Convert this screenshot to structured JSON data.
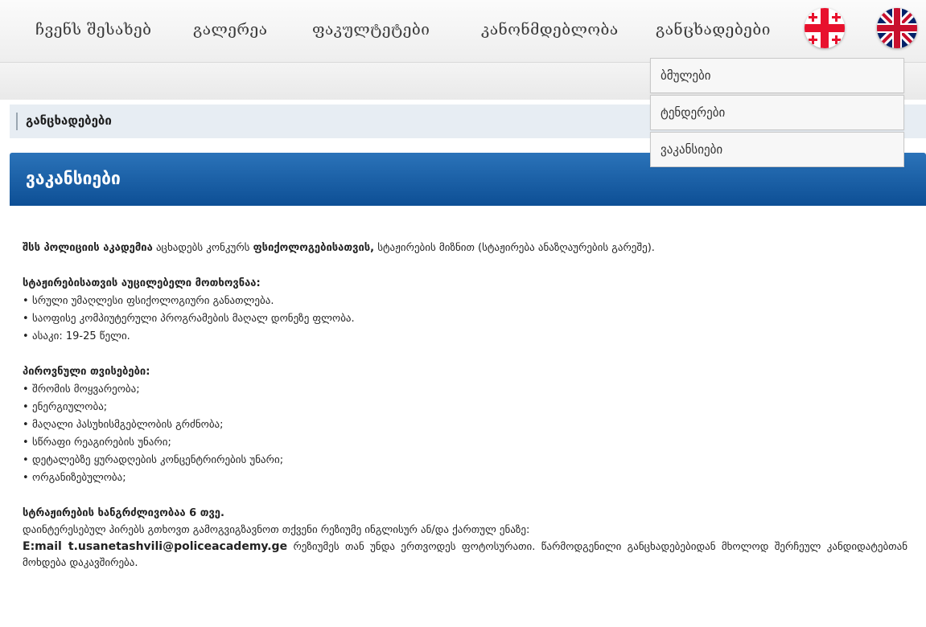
{
  "nav": {
    "items": [
      {
        "label": "ჩვენს შესახებ"
      },
      {
        "label": "გალერეა"
      },
      {
        "label": "ფაკულტეტები"
      },
      {
        "label": "კანონმდებლობა"
      },
      {
        "label": "განცხადებები"
      }
    ]
  },
  "flags": [
    {
      "icon": "georgia-flag-icon"
    },
    {
      "icon": "uk-flag-icon"
    }
  ],
  "breadcrumb": {
    "current": "განცხადებები"
  },
  "dropdown": {
    "items": [
      {
        "label": "ბმულები"
      },
      {
        "label": "ტენდერები"
      },
      {
        "label": "ვაკანსიები"
      }
    ]
  },
  "section": {
    "title": "ვაკანსიები"
  },
  "content": {
    "intro_org": "შსს პოლიციის აკადემია",
    "intro_mid": " აცხადებს კონკურს ",
    "intro_role": "ფსიქოლოგებისათვის,",
    "intro_end": " სტაჟირების მიზნით (სტაჟირება ანაზღაურების გარეშე).",
    "requirements_title": "სტაჟირებისათვის აუცილებელი მოთხოვნაა:",
    "requirements": [
      "სრული უმაღლესი ფსიქოლოგიური განათლება.",
      "საოფისე კომპიუტერული პროგრამების მაღალ დონეზე ფლობა.",
      "ასაკი: 19-25 წელი."
    ],
    "qualities_title": "პიროვნული თვისებები:",
    "qualities": [
      "შრომის მოყვარეობა;",
      "ენერგიულობა;",
      "მაღალი პასუხისმგებლობის გრძნობა;",
      "სწრაფი რეაგირების უნარი;",
      "დეტალებზე ყურადღების კონცენტრირების უნარი;",
      "ორგანიზებულობა;"
    ],
    "duration_title": "სტრაჟირების ხანგრძლივობაა 6 თვე.",
    "apply_text": "დაინტერესებულ პირებს გთხოვთ გამოგვიგზავნოთ თქვენი რეზიუმე ინგლისურ ან/და ქართულ ენაზე:",
    "email": "E:mail t.usanetashvili@policeacademy.ge",
    "apply_tail": " რეზიუმეს თან უნდა ერთვოდეს ფოტოსურათი. წარმოდგენილი განცხადებებიდან მხოლოდ შერჩეულ კანდიდატებთან მოხდება დაკავშირება."
  }
}
